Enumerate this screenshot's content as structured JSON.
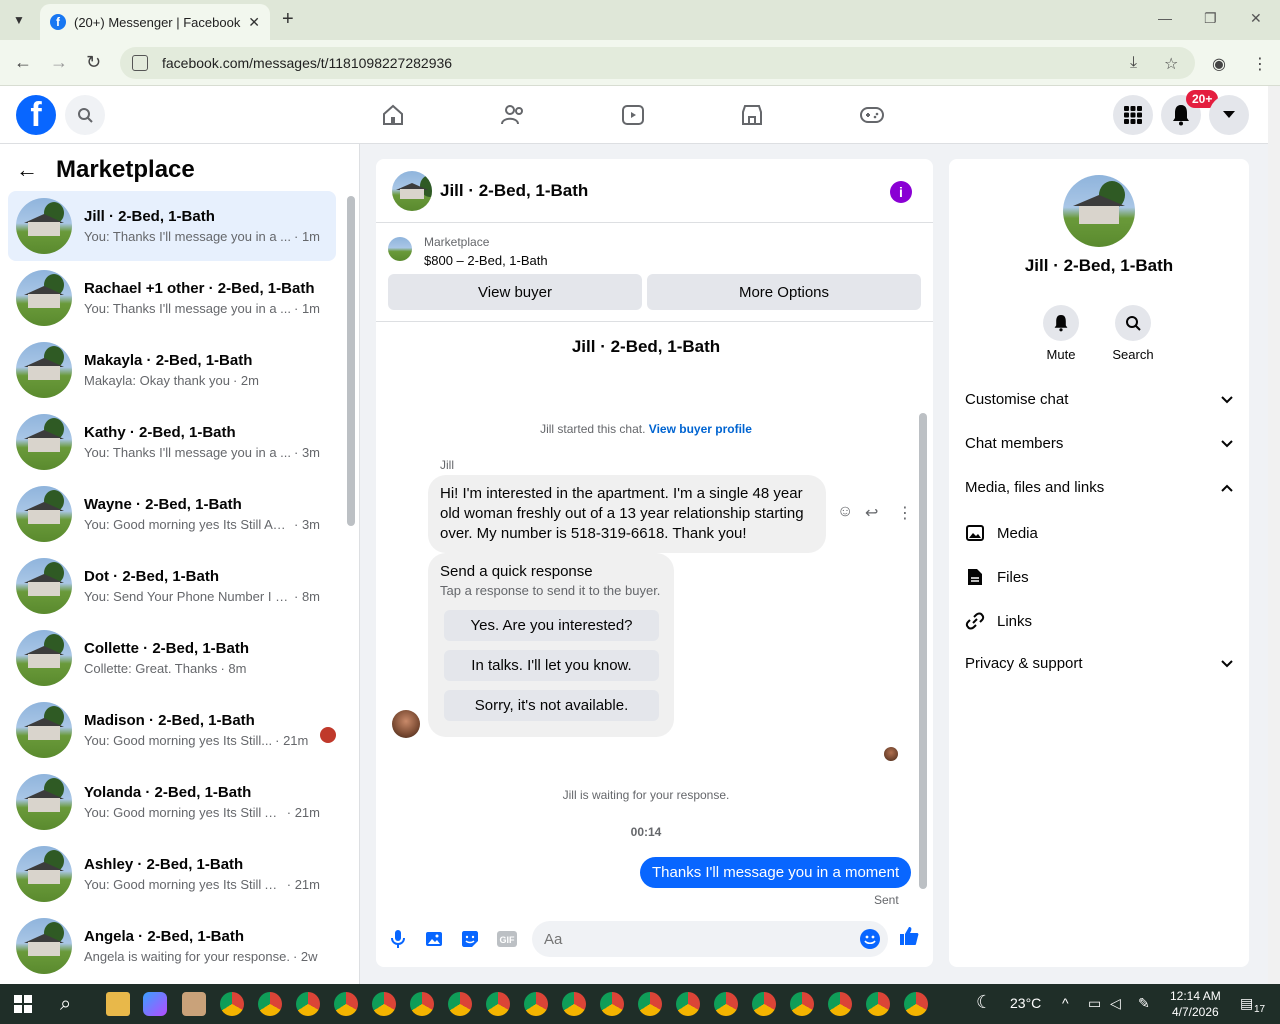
{
  "browser": {
    "tab_title": "(20+) Messenger | Facebook",
    "url": "facebook.com/messages/t/1181098227282936"
  },
  "fbnav": {
    "notif_badge": "20+"
  },
  "sidebar": {
    "title": "Marketplace",
    "conversations": [
      {
        "name": "Jill · 2-Bed, 1-Bath",
        "msg": "You: Thanks I'll message you in a ...",
        "time": "· 1m"
      },
      {
        "name": "Rachael +1 other · 2-Bed, 1-Bath",
        "msg": "You: Thanks I'll message you in a ...",
        "time": "· 1m"
      },
      {
        "name": "Makayla · 2-Bed, 1-Bath",
        "msg": "Makayla: Okay thank you",
        "time": "· 2m"
      },
      {
        "name": "Kathy · 2-Bed, 1-Bath",
        "msg": "You: Thanks I'll message you in a ...",
        "time": "· 3m"
      },
      {
        "name": "Wayne · 2-Bed, 1-Bath",
        "msg": "You: Good morning yes Its Still Ava...",
        "time": "· 3m"
      },
      {
        "name": "Dot · 2-Bed, 1-Bath",
        "msg": "You: Send Your Phone Number I W...",
        "time": "· 8m"
      },
      {
        "name": "Collette · 2-Bed, 1-Bath",
        "msg": "Collette: Great. Thanks",
        "time": "· 8m"
      },
      {
        "name": "Madison · 2-Bed, 1-Bath",
        "msg": "You: Good morning yes Its Still...",
        "time": "· 21m"
      },
      {
        "name": "Yolanda · 2-Bed, 1-Bath",
        "msg": "You: Good morning yes Its Still Av...",
        "time": "· 21m"
      },
      {
        "name": "Ashley · 2-Bed, 1-Bath",
        "msg": "You: Good morning yes Its Still Av...",
        "time": "· 21m"
      },
      {
        "name": "Angela · 2-Bed, 1-Bath",
        "msg": "Angela is waiting for your response.",
        "time": "· 2w"
      }
    ]
  },
  "chat": {
    "title": "Jill · 2-Bed, 1-Bath",
    "marketplace_label": "Marketplace",
    "listing": "$800 – 2-Bed, 1-Bath",
    "view_buyer": "View buyer",
    "more_options": "More Options",
    "name_mid": "Jill · 2-Bed, 1-Bath",
    "started_text": "Jill started this chat.",
    "view_buyer_profile": "View buyer profile",
    "sender": "Jill",
    "incoming_message": "Hi! I'm interested in the apartment. I'm a single 48 year old woman freshly out of a 13 year relationship starting over. My number is 518-319-6618. Thank you!",
    "quick_title": "Send a quick response",
    "quick_sub": "Tap a response to send it to the buyer.",
    "quick_responses": [
      "Yes. Are you interested?",
      "In talks. I'll let you know.",
      "Sorry, it's not available."
    ],
    "waiting": "Jill is waiting for your response.",
    "time": "00:14",
    "outgoing_message": "Thanks I'll message you in a moment",
    "sent_label": "Sent",
    "composer_placeholder": "Aa"
  },
  "rpanel": {
    "name": "Jill · 2-Bed, 1-Bath",
    "mute": "Mute",
    "search": "Search",
    "customise_chat": "Customise chat",
    "chat_members": "Chat members",
    "media_files_links": "Media, files and links",
    "media": "Media",
    "files": "Files",
    "links": "Links",
    "privacy_support": "Privacy & support"
  },
  "taskbar": {
    "weather": "23°C",
    "time": "12:14 AM",
    "date": "4/7/2026",
    "notif_count": "17"
  },
  "colors": {
    "accent": "#0866ff",
    "info": "#8a00d4",
    "badge": "#e41e3f"
  }
}
